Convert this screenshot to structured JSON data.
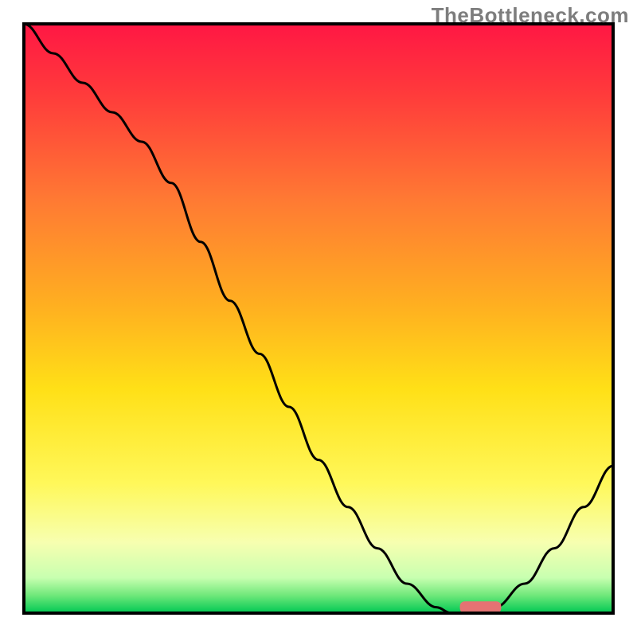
{
  "watermark": "TheBottleneck.com",
  "colors": {
    "frame": "#000000",
    "curve": "#000000",
    "marker": "#e57373",
    "gradient_stops": [
      {
        "offset": 0,
        "color": "#ff1744"
      },
      {
        "offset": 0.12,
        "color": "#ff3b3b"
      },
      {
        "offset": 0.3,
        "color": "#ff7a33"
      },
      {
        "offset": 0.48,
        "color": "#ffb020"
      },
      {
        "offset": 0.62,
        "color": "#ffe017"
      },
      {
        "offset": 0.78,
        "color": "#fff85a"
      },
      {
        "offset": 0.88,
        "color": "#f7ffb0"
      },
      {
        "offset": 0.94,
        "color": "#c8ffb0"
      },
      {
        "offset": 0.97,
        "color": "#6fe87a"
      },
      {
        "offset": 1.0,
        "color": "#00c853"
      }
    ]
  },
  "chart_data": {
    "type": "line",
    "description": "Bottleneck percentage curve against a suitability gradient (red = high bottleneck, green = ideal). Unlabeled axes; x is a hardware balance parameter from 0 to 1, y is bottleneck percentage from 0 to 100.",
    "xlabel": "",
    "ylabel": "",
    "xlim": [
      0,
      1
    ],
    "ylim": [
      0,
      100
    ],
    "x": [
      0.0,
      0.05,
      0.1,
      0.15,
      0.2,
      0.25,
      0.3,
      0.35,
      0.4,
      0.45,
      0.5,
      0.55,
      0.6,
      0.65,
      0.7,
      0.725,
      0.75,
      0.8,
      0.85,
      0.9,
      0.95,
      1.0
    ],
    "values": [
      100,
      95,
      90,
      85,
      80,
      73,
      63,
      53,
      44,
      35,
      26,
      18,
      11,
      5,
      1,
      0,
      0,
      1,
      5,
      11,
      18,
      25
    ],
    "marker": {
      "x": 0.74,
      "width_x": 0.07,
      "y": 0,
      "height_y": 2
    }
  }
}
